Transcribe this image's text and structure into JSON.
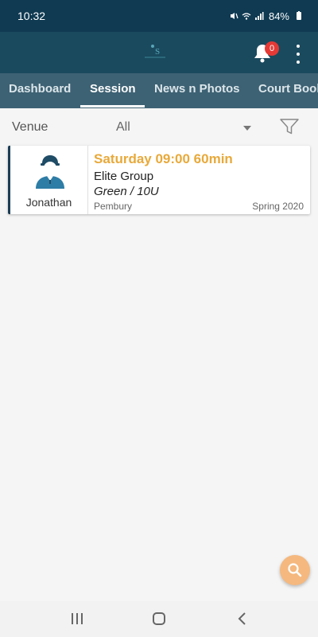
{
  "status_bar": {
    "time": "10:32",
    "battery": "84%",
    "icons": [
      "mute-icon",
      "wifi-icon",
      "signal-icon",
      "battery-icon"
    ]
  },
  "header": {
    "logo_icon": "tennis-logo-icon",
    "notifications_count": "0"
  },
  "tabs": [
    {
      "label": "Dashboard",
      "active": false
    },
    {
      "label": "Session",
      "active": true
    },
    {
      "label": "News n Photos",
      "active": false
    },
    {
      "label": "Court Book",
      "active": false
    }
  ],
  "filter": {
    "venue_label": "Venue",
    "venue_value": "All"
  },
  "session": {
    "coach_name": "Jonathan",
    "title": "Saturday 09:00 60min",
    "group": "Elite Group",
    "level": "Green / 10U",
    "location": "Pembury",
    "term": "Spring 2020"
  },
  "colors": {
    "status_bar": "#0f3a52",
    "header": "#1a4a5e",
    "tabs": "#3d6274",
    "accent": "#e8a93a",
    "fab": "#f5b87e",
    "badge": "#e53935"
  }
}
